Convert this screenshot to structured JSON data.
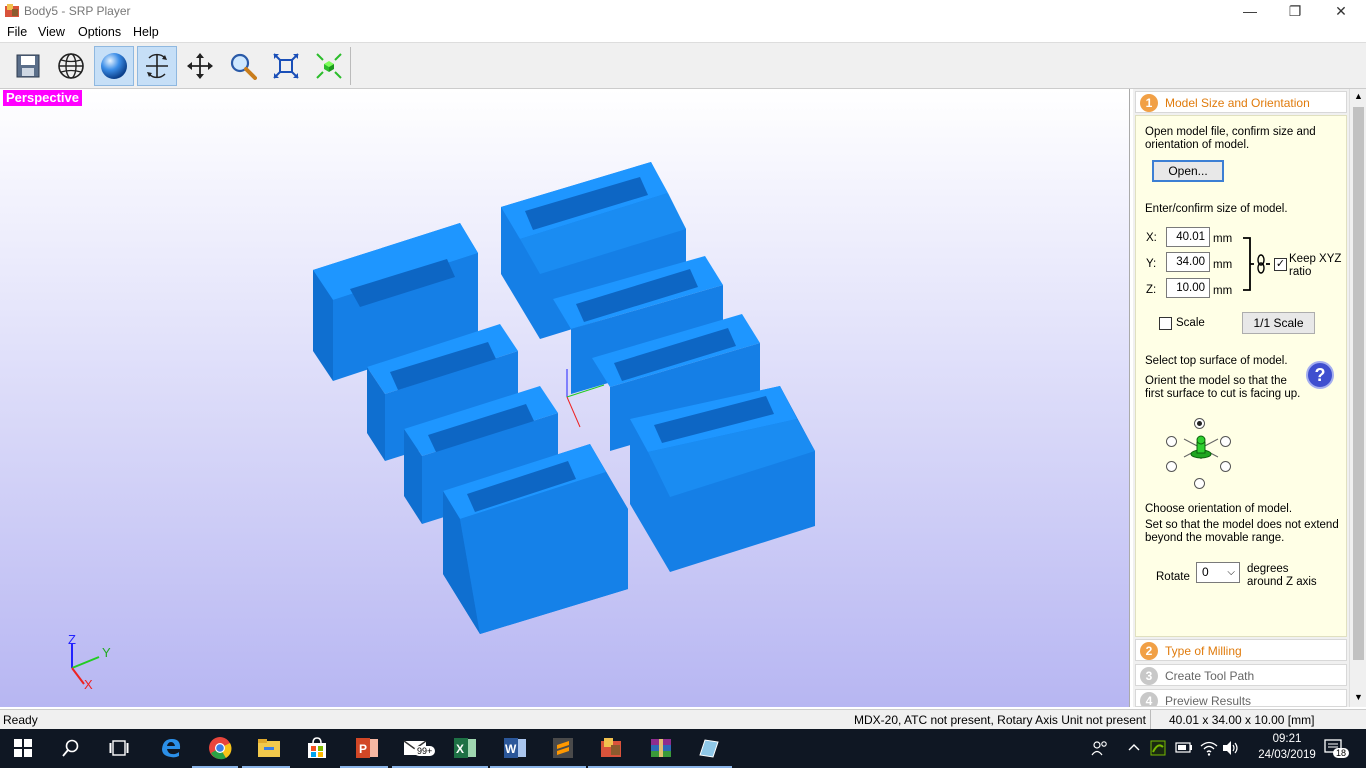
{
  "window": {
    "title": "Body5 - SRP Player",
    "minimize_glyph": "—",
    "maximize_glyph": "❐",
    "close_glyph": "✕"
  },
  "menu": [
    "File",
    "View",
    "Options",
    "Help"
  ],
  "toolbar": {
    "buttons": [
      {
        "name": "save-icon",
        "active": false
      },
      {
        "name": "globe-wireframe-icon",
        "active": false
      },
      {
        "name": "sphere-shaded-icon",
        "active": true
      },
      {
        "name": "rotate-view-icon",
        "active": true
      },
      {
        "name": "move-icon",
        "active": false
      },
      {
        "name": "zoom-icon",
        "active": false
      },
      {
        "name": "fit-to-window-icon",
        "active": false
      },
      {
        "name": "center-view-icon",
        "active": false
      }
    ]
  },
  "viewport": {
    "view_label": "Perspective",
    "axis_labels": {
      "z": "Z",
      "y": "Y",
      "x": "X"
    },
    "model_color": "#1a8cf2"
  },
  "panel": {
    "sections": [
      {
        "num": "1",
        "label": "Model Size and Orientation",
        "active": true
      },
      {
        "num": "2",
        "label": "Type of Milling",
        "active": false
      },
      {
        "num": "3",
        "label": "Create Tool Path",
        "active": false
      },
      {
        "num": "4",
        "label": "Preview Results",
        "active": false
      }
    ],
    "open_instructions": "Open model file, confirm size and orientation of model.",
    "open_button": "Open...",
    "size_instructions": "Enter/confirm size of model.",
    "dims": [
      {
        "axis": "X:",
        "value": "40.01",
        "unit": "mm"
      },
      {
        "axis": "Y:",
        "value": "34.00",
        "unit": "mm"
      },
      {
        "axis": "Z:",
        "value": "10.00",
        "unit": "mm"
      }
    ],
    "keep_ratio_label": "Keep XYZ ratio",
    "keep_ratio_checked": true,
    "scale_label": "Scale",
    "scale_checked": false,
    "one_to_one_button": "1/1 Scale",
    "top_surface_title": "Select top surface of model.",
    "top_surface_desc": "Orient the model so that the first surface to cut is facing up.",
    "help_glyph": "?",
    "orientation_title": "Choose orientation of model.",
    "orientation_desc": "Set so that the model does not extend beyond the movable range.",
    "rotate_label": "Rotate",
    "rotate_value": "0",
    "rotate_unit": "degrees around Z axis"
  },
  "status": {
    "left": "Ready",
    "machine": "MDX-20, ATC not present, Rotary Axis Unit not present",
    "size": "40.01 x  34.00 x  10.00 [mm]"
  },
  "taskbar": {
    "mail_badge": "99+",
    "time": "09:21",
    "date": "24/03/2019",
    "notifications": "18"
  }
}
